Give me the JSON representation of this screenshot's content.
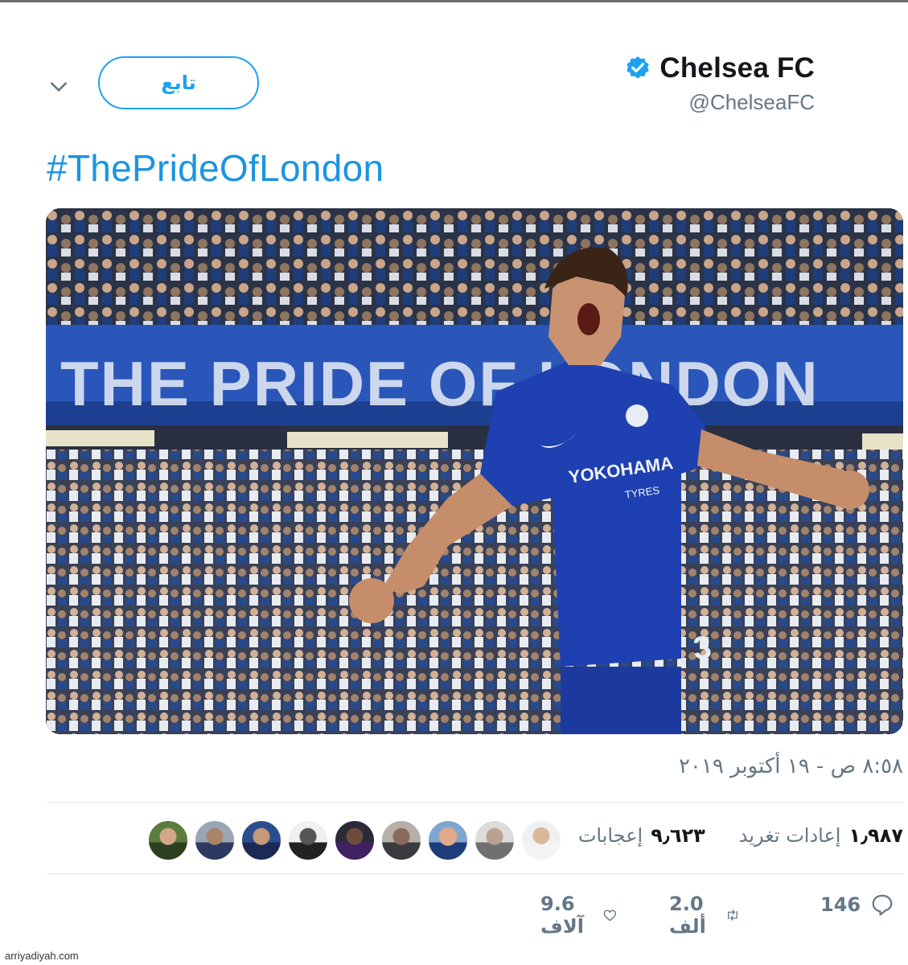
{
  "colors": {
    "accent": "#1da1f2",
    "link": "#1b95e0",
    "muted": "#657786"
  },
  "header": {
    "display_name": "Chelsea FC",
    "handle": "@ChelseaFC",
    "follow_label": "تابع",
    "verified_icon": "verified-badge-icon",
    "more_icon": "chevron-down-icon"
  },
  "tweet": {
    "text": "#ThePrideOfLondon",
    "image": {
      "banner_text": "THE PRIDE OF LONDON",
      "sponsor_text": "YOKOHAMA",
      "sponsor_sub": "TYRES",
      "shirt_number": "3"
    },
    "timestamp": "٨:٥٨ ص - ١٩ أكتوبر ٢٠١٩"
  },
  "stats": {
    "retweets_count": "١٫٩٨٧",
    "retweets_label": "إعادات تغريد",
    "likes_count": "٩٫٦٢٣",
    "likes_label": "إعجابات",
    "liker_avatars": 9
  },
  "actions": {
    "replies": "146",
    "retweets": "2.0 ألف",
    "likes": "9.6 آلاف"
  },
  "watermark": "arriyadiyah.com"
}
